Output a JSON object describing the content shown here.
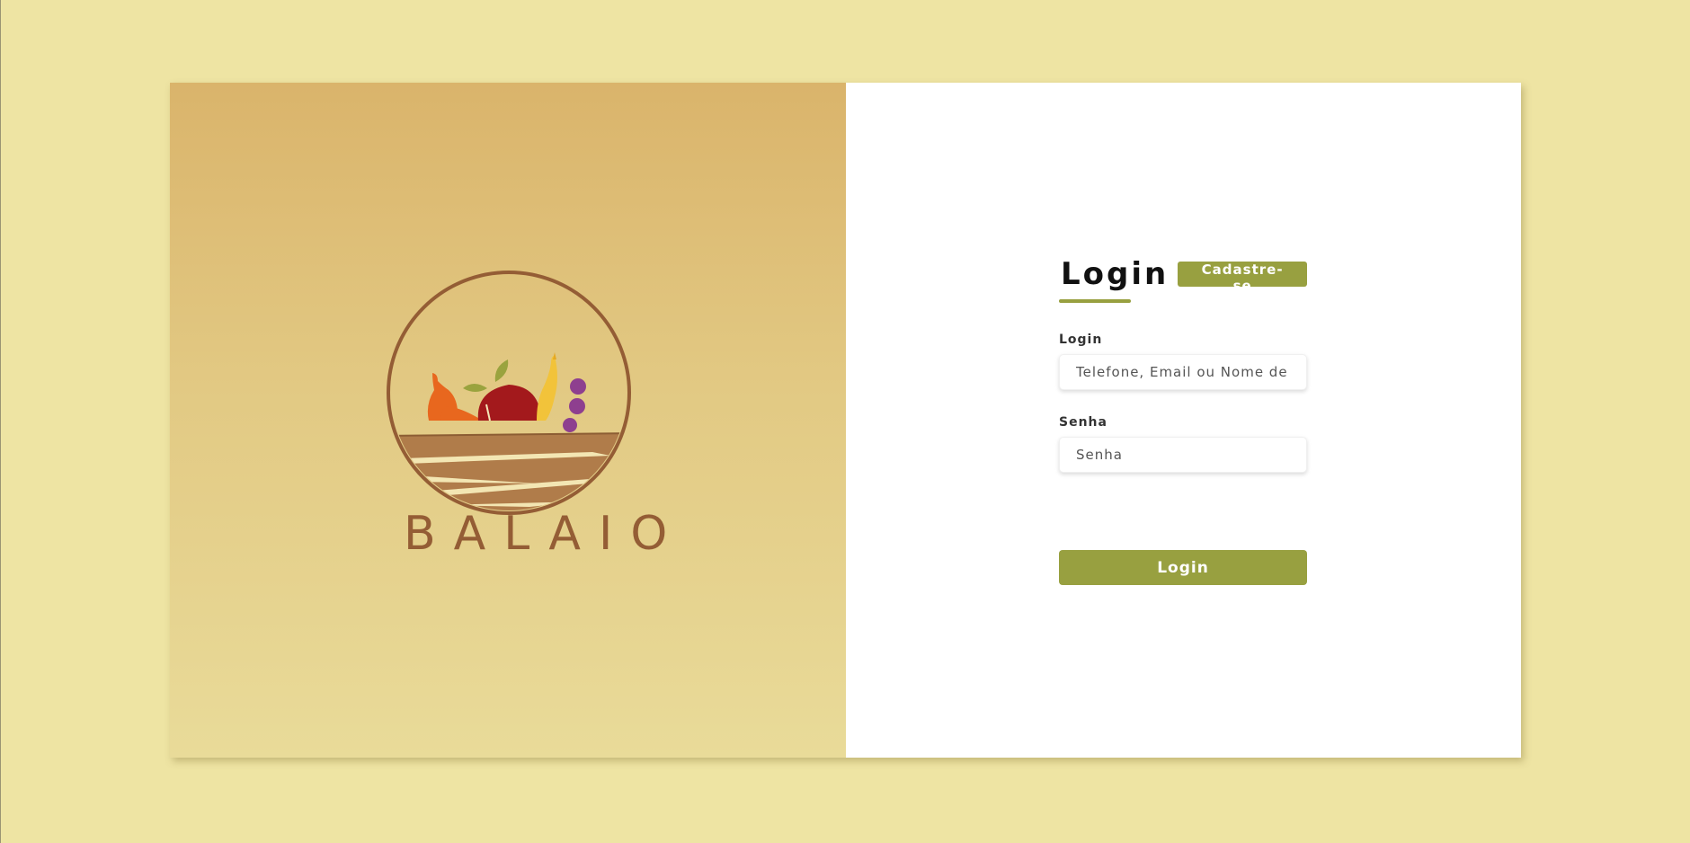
{
  "brand": {
    "name": "BALAIO",
    "logo_icon": "fruit-basket-icon"
  },
  "form": {
    "tabs": {
      "login_label": "Login",
      "signup_label": "Cadastre-se"
    },
    "login_field": {
      "label": "Login",
      "placeholder": "Telefone, Email ou Nome de"
    },
    "password_field": {
      "label": "Senha",
      "placeholder": "Senha"
    },
    "submit_label": "Login"
  },
  "colors": {
    "page_background": "#eee4a3",
    "accent": "#98a040",
    "brand_brown": "#945d35"
  }
}
